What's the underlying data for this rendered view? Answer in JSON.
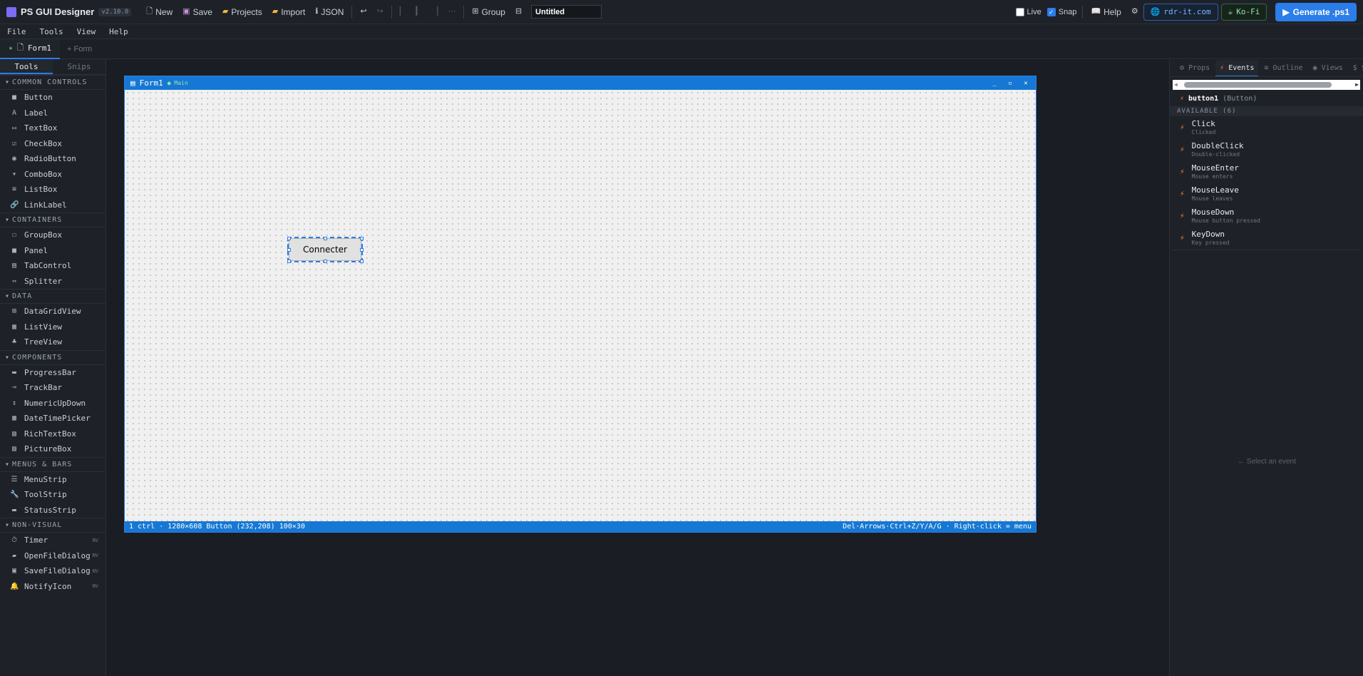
{
  "app": {
    "title": "PS GUI Designer",
    "version": "v2.10.0"
  },
  "toolbar": {
    "new": "New",
    "save": "Save",
    "projects": "Projects",
    "import": "Import",
    "json": "JSON",
    "group": "Group",
    "title_value": "Untitled",
    "live": "Live",
    "snap": "Snap",
    "help": "Help",
    "site": "rdr-it.com",
    "kofi": "Ko-Fi",
    "generate": "Generate .ps1"
  },
  "menu": [
    "File",
    "Tools",
    "View",
    "Help"
  ],
  "tabs": {
    "form1": "Form1",
    "add_form": "+ Form"
  },
  "left_panel": {
    "tabs": [
      "Tools",
      "Snips"
    ],
    "categories": [
      {
        "name": "COMMON CONTROLS",
        "items": [
          "Button",
          "Label",
          "TextBox",
          "CheckBox",
          "RadioButton",
          "ComboBox",
          "ListBox",
          "LinkLabel"
        ]
      },
      {
        "name": "CONTAINERS",
        "items": [
          "GroupBox",
          "Panel",
          "TabControl",
          "Splitter"
        ]
      },
      {
        "name": "DATA",
        "items": [
          "DataGridView",
          "ListView",
          "TreeView"
        ]
      },
      {
        "name": "COMPONENTS",
        "items": [
          "ProgressBar",
          "TrackBar",
          "NumericUpDown",
          "DateTimePicker",
          "RichTextBox",
          "PictureBox"
        ]
      },
      {
        "name": "MENUS & BARS",
        "items": [
          "MenuStrip",
          "ToolStrip",
          "StatusStrip"
        ]
      },
      {
        "name": "NON-VISUAL",
        "items": [
          "Timer",
          "OpenFileDialog",
          "SaveFileDialog",
          "NotifyIcon"
        ],
        "badge": "NV"
      }
    ]
  },
  "form": {
    "title": "Form1",
    "tag": "Main",
    "button_text": "Connecter",
    "status_left": "1 ctrl · 1280×608  Button (232,208) 100×30",
    "status_right": "Del·Arrows·Ctrl+Z/Y/A/G · Right-click = menu"
  },
  "right_panel": {
    "tabs": [
      "Props",
      "Events",
      "Outline",
      "Views",
      "$ $("
    ],
    "selected": {
      "name": "button1",
      "type": "(Button)"
    },
    "available": "AVAILABLE (6)",
    "events": [
      {
        "name": "Click",
        "desc": "Clicked"
      },
      {
        "name": "DoubleClick",
        "desc": "Double-clicked"
      },
      {
        "name": "MouseEnter",
        "desc": "Mouse enters"
      },
      {
        "name": "MouseLeave",
        "desc": "Mouse leaves"
      },
      {
        "name": "MouseDown",
        "desc": "Mouse button pressed"
      },
      {
        "name": "KeyDown",
        "desc": "Key pressed"
      }
    ],
    "hint": "← Select an event"
  }
}
